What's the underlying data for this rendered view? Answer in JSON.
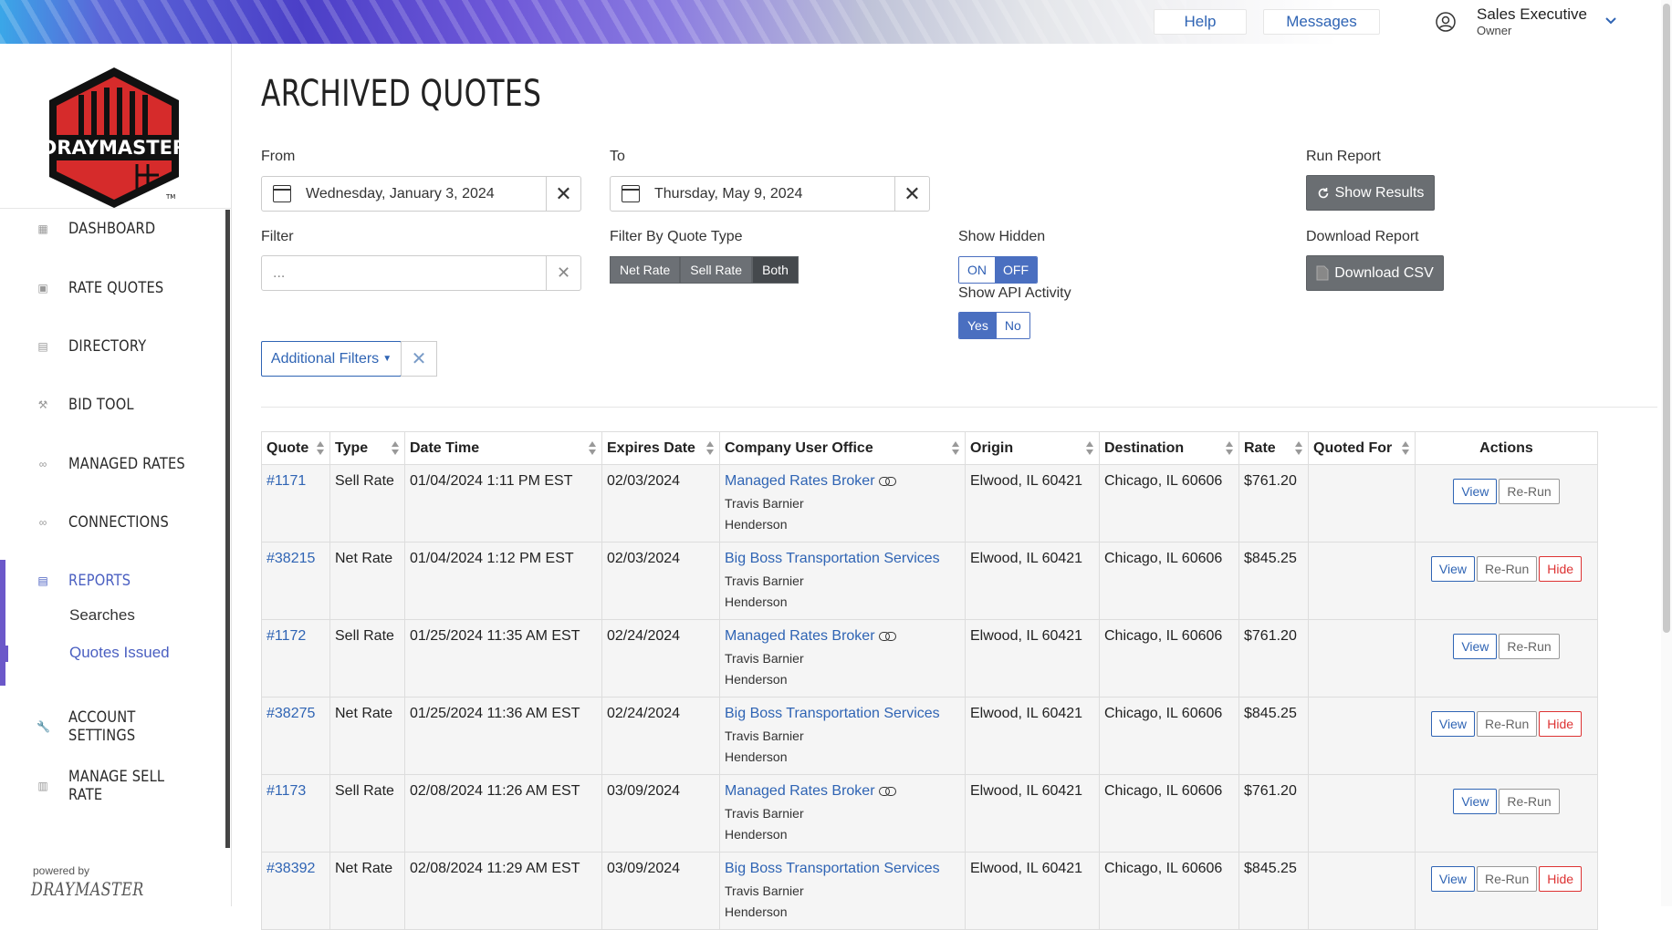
{
  "topbar": {
    "help": "Help",
    "messages": "Messages",
    "user_name": "Sales Executive",
    "user_role": "Owner"
  },
  "brand": {
    "logo_text": "DRAYMASTER",
    "tm": "TM",
    "powered_by": "powered by",
    "powered_brand": "DRAYMASTER"
  },
  "nav": [
    {
      "label": "DASHBOARD",
      "icon": "dashboard-icon"
    },
    {
      "label": "RATE QUOTES",
      "icon": "rate-quotes-icon"
    },
    {
      "label": "DIRECTORY",
      "icon": "directory-icon"
    },
    {
      "label": "BID TOOL",
      "icon": "gavel-icon"
    },
    {
      "label": "MANAGED RATES",
      "icon": "link-icon"
    },
    {
      "label": "CONNECTIONS",
      "icon": "link-icon"
    },
    {
      "label": "REPORTS",
      "icon": "reports-icon"
    },
    {
      "label": "ACCOUNT SETTINGS",
      "icon": "wrench-icon"
    },
    {
      "label": "MANAGE SELL RATE",
      "icon": "sell-rate-icon"
    }
  ],
  "reports_sub": [
    "Searches",
    "Quotes Issued"
  ],
  "page": {
    "title": "ARCHIVED QUOTES"
  },
  "filters": {
    "from_label": "From",
    "from_value": "Wednesday, January 3, 2024",
    "to_label": "To",
    "to_value": "Thursday, May 9, 2024",
    "run_report_label": "Run Report",
    "show_results": "Show Results",
    "filter_label": "Filter",
    "filter_placeholder": "...",
    "quote_type_label": "Filter By Quote Type",
    "quote_types": [
      "Net Rate",
      "Sell Rate",
      "Both"
    ],
    "quote_type_selected": "Both",
    "show_hidden_label": "Show Hidden",
    "show_hidden_on": "ON",
    "show_hidden_off": "OFF",
    "show_hidden_value": "OFF",
    "api_label": "Show API Activity",
    "api_yes": "Yes",
    "api_no": "No",
    "api_value": "Yes",
    "download_label": "Download Report",
    "download_csv": "Download CSV",
    "additional_filters": "Additional Filters"
  },
  "table": {
    "headers": [
      "Quote",
      "Type",
      "Date Time",
      "Expires Date",
      "Company User Office",
      "Origin",
      "Destination",
      "Rate",
      "Quoted For",
      "Actions"
    ],
    "actions": {
      "view": "View",
      "rerun": "Re-Run",
      "hide": "Hide"
    },
    "rows": [
      {
        "quote": "#1171",
        "type": "Sell Rate",
        "datetime": "01/04/2024 1:11 PM EST",
        "expires": "02/03/2024",
        "company": "Managed Rates Broker",
        "linked": true,
        "user": "Travis Barnier",
        "office": "Henderson",
        "origin": "Elwood, IL 60421",
        "destination": "Chicago, IL 60606",
        "rate": "$761.20",
        "quoted_for": "",
        "hide": false
      },
      {
        "quote": "#38215",
        "type": "Net Rate",
        "datetime": "01/04/2024 1:12 PM EST",
        "expires": "02/03/2024",
        "company": "Big Boss Transportation Services",
        "linked": false,
        "user": "Travis Barnier",
        "office": "Henderson",
        "origin": "Elwood, IL 60421",
        "destination": "Chicago, IL 60606",
        "rate": "$845.25",
        "quoted_for": "",
        "hide": true
      },
      {
        "quote": "#1172",
        "type": "Sell Rate",
        "datetime": "01/25/2024 11:35 AM EST",
        "expires": "02/24/2024",
        "company": "Managed Rates Broker",
        "linked": true,
        "user": "Travis Barnier",
        "office": "Henderson",
        "origin": "Elwood, IL 60421",
        "destination": "Chicago, IL 60606",
        "rate": "$761.20",
        "quoted_for": "",
        "hide": false
      },
      {
        "quote": "#38275",
        "type": "Net Rate",
        "datetime": "01/25/2024 11:36 AM EST",
        "expires": "02/24/2024",
        "company": "Big Boss Transportation Services",
        "linked": false,
        "user": "Travis Barnier",
        "office": "Henderson",
        "origin": "Elwood, IL 60421",
        "destination": "Chicago, IL 60606",
        "rate": "$845.25",
        "quoted_for": "",
        "hide": true
      },
      {
        "quote": "#1173",
        "type": "Sell Rate",
        "datetime": "02/08/2024 11:26 AM EST",
        "expires": "03/09/2024",
        "company": "Managed Rates Broker",
        "linked": true,
        "user": "Travis Barnier",
        "office": "Henderson",
        "origin": "Elwood, IL 60421",
        "destination": "Chicago, IL 60606",
        "rate": "$761.20",
        "quoted_for": "",
        "hide": false
      },
      {
        "quote": "#38392",
        "type": "Net Rate",
        "datetime": "02/08/2024 11:29 AM EST",
        "expires": "03/09/2024",
        "company": "Big Boss Transportation Services",
        "linked": false,
        "user": "Travis Barnier",
        "office": "Henderson",
        "origin": "Elwood, IL 60421",
        "destination": "Chicago, IL 60606",
        "rate": "$845.25",
        "quoted_for": "",
        "hide": true
      }
    ]
  }
}
